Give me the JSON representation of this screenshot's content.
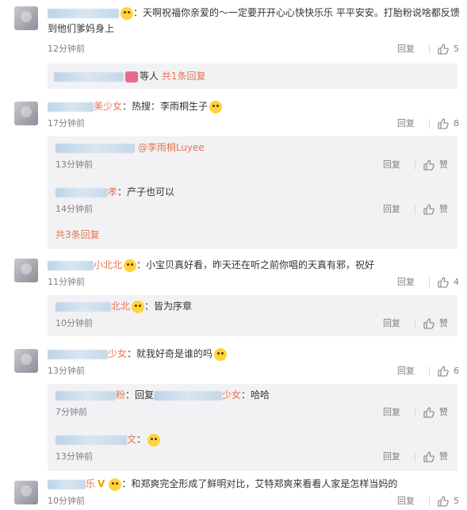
{
  "comments": [
    {
      "name_suffix": "",
      "text": "：天啊祝福你亲爱的～一定要开开心心快快乐乐 平平安安。打胎粉说啥都反馈",
      "text2": "到他们爹妈身上",
      "time": "12分钟前",
      "reply": "回复",
      "likes": "5",
      "reply_summary": {
        "mid": "等人",
        "link": "共1条回复"
      }
    },
    {
      "name_suffix": "美少女",
      "text": "：热搜：李雨桐生子",
      "time": "17分钟前",
      "reply": "回复",
      "likes": "8",
      "subs": [
        {
          "mention": "@李雨桐Luyee",
          "time": "13分钟前",
          "reply": "回复",
          "likes": "赞"
        },
        {
          "name_suffix": "孝",
          "text": "：产子也可以",
          "time": "14分钟前",
          "reply": "回复",
          "likes": "赞"
        }
      ],
      "more": "共3条回复"
    },
    {
      "name_suffix": "小北北",
      "text": "：小宝贝真好看，昨天还在听之前你唱的天真有邪，祝好",
      "time": "11分钟前",
      "reply": "回复",
      "likes": "4",
      "subs": [
        {
          "name_suffix": "北北",
          "text": "：皆为序章",
          "time": "10分钟前",
          "reply": "回复",
          "likes": "赞"
        }
      ]
    },
    {
      "name_suffix": "少女",
      "text": "：就我好奇是谁的吗",
      "time": "13分钟前",
      "reply": "回复",
      "likes": "6",
      "subs": [
        {
          "name_suffix": "粉",
          "text_a": "：回复",
          "name2_suffix": "少女",
          "text_b": "：哈哈",
          "time": "7分钟前",
          "reply": "回复",
          "likes": "赞"
        },
        {
          "name_suffix": "文",
          "text": "：",
          "time": "13分钟前",
          "reply": "回复",
          "likes": "赞"
        }
      ]
    },
    {
      "name_suffix": "乐",
      "text": "：和郑爽完全形成了鲜明对比，艾特郑爽来看看人家是怎样当妈的",
      "time": "10分钟前",
      "reply": "回复",
      "likes": "5"
    }
  ],
  "colors": {
    "accent": "#eb7350",
    "muted": "#808080",
    "panel": "#f2f2f5"
  }
}
